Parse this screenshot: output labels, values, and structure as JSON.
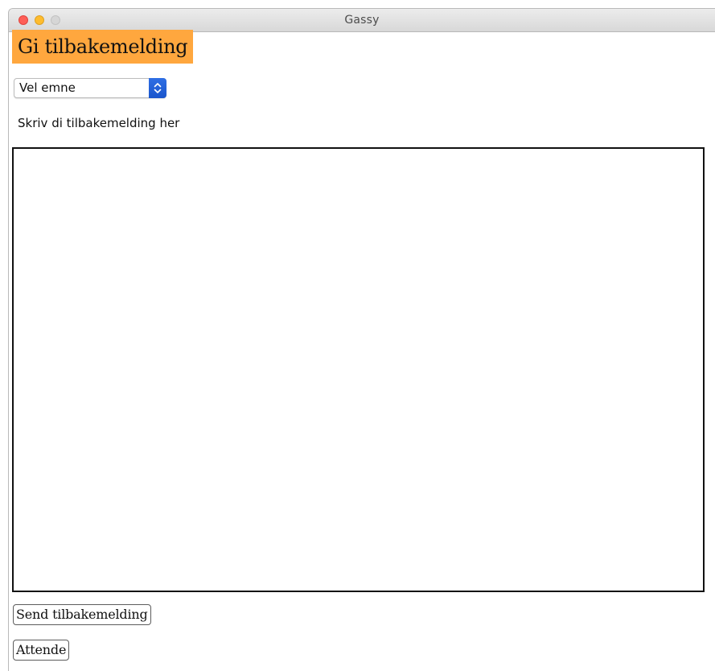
{
  "window": {
    "title": "Gassy"
  },
  "page": {
    "title": "Gi tilbakemelding",
    "title_background": "#ffa73e"
  },
  "topic_select": {
    "selected": "Vel emne",
    "accent": "#1a56cc",
    "icon": "up-down-chevron-icon"
  },
  "feedback": {
    "label": "Skriv di tilbakemelding her",
    "value": ""
  },
  "buttons": {
    "send_label": "Send tilbakemelding",
    "back_label": "Attende"
  }
}
